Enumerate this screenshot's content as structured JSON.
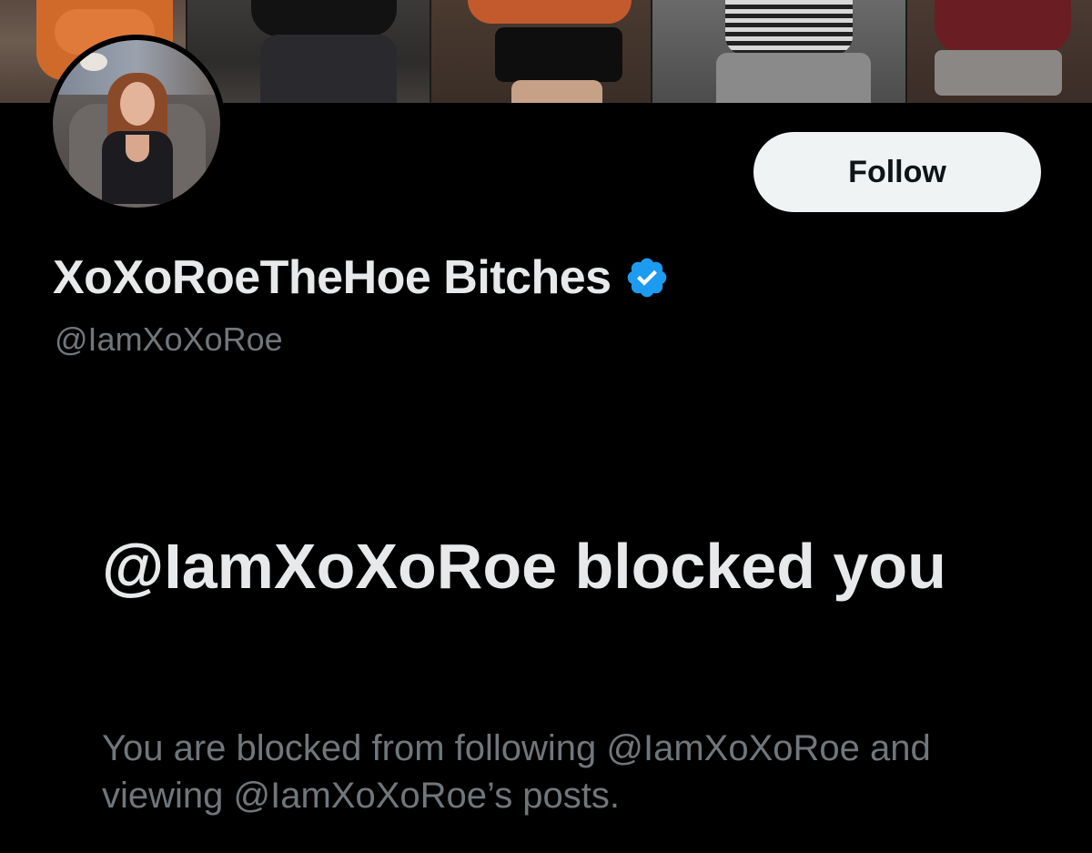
{
  "profile": {
    "display_name": "XoXoRoeTheHoe Bitches",
    "handle": "@IamXoXoRoe",
    "verified": true,
    "verified_icon": "verified-badge-icon",
    "verified_color": "#1d9bf0"
  },
  "actions": {
    "follow_label": "Follow"
  },
  "blocked_notice": {
    "title": "@IamXoXoRoe blocked you",
    "description": "You are blocked from following @IamXoXoRoe and viewing @IamXoXoRoe’s posts."
  },
  "theme": {
    "background": "#000000",
    "primary_text": "#e7e9ea",
    "secondary_text": "#71767b",
    "button_background": "#eff3f4",
    "button_text": "#0f1419"
  }
}
